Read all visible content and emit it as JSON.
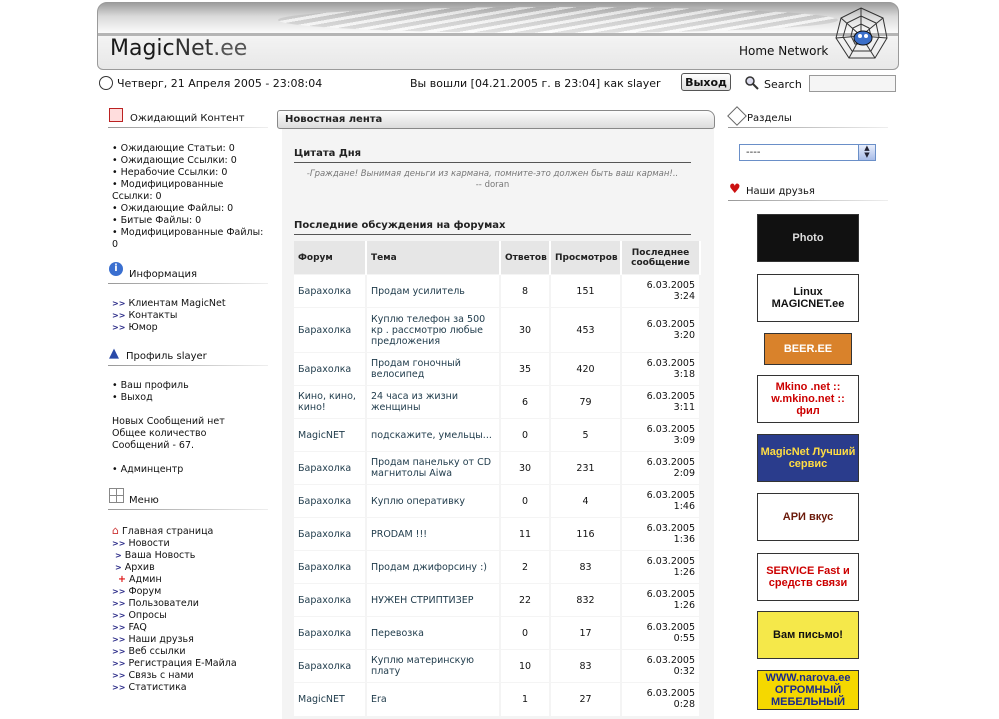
{
  "header": {
    "logo_magic": "Magic",
    "logo_net": "Net",
    "logo_ee": ".ee",
    "home_network": "Home Network"
  },
  "topbar": {
    "date": "Четверг, 21 Апреля 2005 - 23:08:04",
    "login_status": "Вы вошли [04.21.2005 г. в 23:04] как slayer",
    "logout_label": "Выход",
    "search_label": "Search",
    "search_value": ""
  },
  "left": {
    "pending": {
      "title": "Ожидающий Контент",
      "items": [
        "• Ожидающие Статьи: 0",
        "• Ожидающие Ссылки: 0",
        "• Нерабочие Ссылки: 0",
        "• Модифицированные",
        "Ссылки: 0",
        "• Ожидающие Файлы: 0",
        "• Битые Файлы: 0",
        "• Модифицированные Файлы:",
        "0"
      ]
    },
    "info": {
      "title": "Информация",
      "links": [
        "Клиентам MagicNet",
        "Контакты",
        "Юмор"
      ]
    },
    "profile": {
      "title": "Профиль slayer",
      "links": [
        "• Ваш профиль",
        "• Выход"
      ],
      "messages": "Новых Сообщений нет",
      "total1": "Общее количество",
      "total2": "Сообщений - 67.",
      "admin": "• Админцентр"
    },
    "menu": {
      "title": "Меню",
      "home": "Главная страница",
      "news": "Новости",
      "your_news": "Ваша Новость",
      "archive": "Архив",
      "admin": "Админ",
      "items": [
        "Форум",
        "Пользователи",
        "Опросы",
        "FAQ",
        "Наши друзья",
        "Веб ссылки",
        "Регистрация E-Майла",
        "Связь с нами",
        "Статистика"
      ]
    }
  },
  "center": {
    "news_title": "Новостная лента",
    "quote_title": "Цитата Дня",
    "quote_text": "-Граждане! Вынимая деньги из кармана, помните-это должен быть ваш карман!..",
    "quote_author": "-- doran",
    "forum_title": "Последние обсуждения на форумах",
    "table_headers": [
      "Форум",
      "Тема",
      "Ответов",
      "Просмотров",
      "Последнее сообщение"
    ],
    "rows": [
      {
        "forum": "Барахолка",
        "topic": "Продам усилитель",
        "replies": "8",
        "views": "151",
        "date": "6.03.2005",
        "time": "3:24"
      },
      {
        "forum": "Барахолка",
        "topic": "Куплю телефон за 500 кр . рассмотрю любые предложения",
        "replies": "30",
        "views": "453",
        "date": "6.03.2005",
        "time": "3:20"
      },
      {
        "forum": "Барахолка",
        "topic": "Продам гоночный велосипед",
        "replies": "35",
        "views": "420",
        "date": "6.03.2005",
        "time": "3:18"
      },
      {
        "forum": "Кино, кино, кино!",
        "topic": "24 часа из жизни женщины",
        "replies": "6",
        "views": "79",
        "date": "6.03.2005",
        "time": "3:11"
      },
      {
        "forum": "MagicNET",
        "topic": "подскажите, умельцы...",
        "replies": "0",
        "views": "5",
        "date": "6.03.2005",
        "time": "3:09"
      },
      {
        "forum": "Барахолка",
        "topic": "Продам панельку от CD магнитолы Aiwa",
        "replies": "30",
        "views": "231",
        "date": "6.03.2005",
        "time": "2:09"
      },
      {
        "forum": "Барахолка",
        "topic": "Куплю оперативку",
        "replies": "0",
        "views": "4",
        "date": "6.03.2005",
        "time": "1:46"
      },
      {
        "forum": "Барахолка",
        "topic": "PRODAM !!!",
        "replies": "11",
        "views": "116",
        "date": "6.03.2005",
        "time": "1:36"
      },
      {
        "forum": "Барахолка",
        "topic": "Продам джифорсину :)",
        "replies": "2",
        "views": "83",
        "date": "6.03.2005",
        "time": "1:26"
      },
      {
        "forum": "Барахолка",
        "topic": "НУЖЕН СТРИПТИЗЕР",
        "replies": "22",
        "views": "832",
        "date": "6.03.2005",
        "time": "1:26"
      },
      {
        "forum": "Барахолка",
        "topic": "Перевозка",
        "replies": "0",
        "views": "17",
        "date": "6.03.2005",
        "time": "0:55"
      },
      {
        "forum": "Барахолка",
        "topic": "Куплю материнскую плату",
        "replies": "10",
        "views": "83",
        "date": "6.03.2005",
        "time": "0:32"
      },
      {
        "forum": "MagicNET",
        "topic": "Era",
        "replies": "1",
        "views": "27",
        "date": "6.03.2005",
        "time": "0:28"
      }
    ]
  },
  "right": {
    "sections_title": "Разделы",
    "sections_value": "----",
    "friends_title": "Наши друзья",
    "banners": [
      {
        "text": "Photo",
        "bg": "#111111",
        "fg": "#dddddd"
      },
      {
        "text": "Linux MAGICNET.ee",
        "bg": "#ffffff",
        "fg": "#111111"
      },
      {
        "text": "BEER.EE",
        "bg": "#d9822b",
        "fg": "#ffffff"
      },
      {
        "text": "Mkino .net :: w.mkino.net :: фил",
        "bg": "#ffffff",
        "fg": "#cc0000"
      },
      {
        "text": "MagicNet Лучший сервис",
        "bg": "#2a3c8c",
        "fg": "#ffdd44"
      },
      {
        "text": "АРИ вкус",
        "bg": "#ffffff",
        "fg": "#6b1a0a"
      },
      {
        "text": "SERVICE Fast и средств связи",
        "bg": "#ffffff",
        "fg": "#cc0000"
      },
      {
        "text": "Вам письмо!",
        "bg": "#f5e84a",
        "fg": "#111111"
      },
      {
        "text": "WWW.narova.ee ОГРОМНЫЙ МЕБЕЛЬНЫЙ",
        "bg": "#f5d800",
        "fg": "#1a2a8c"
      }
    ]
  },
  "colors": {
    "accent": "#2a2a88",
    "link": "#1e3a4a",
    "heart": "#cc1111"
  }
}
